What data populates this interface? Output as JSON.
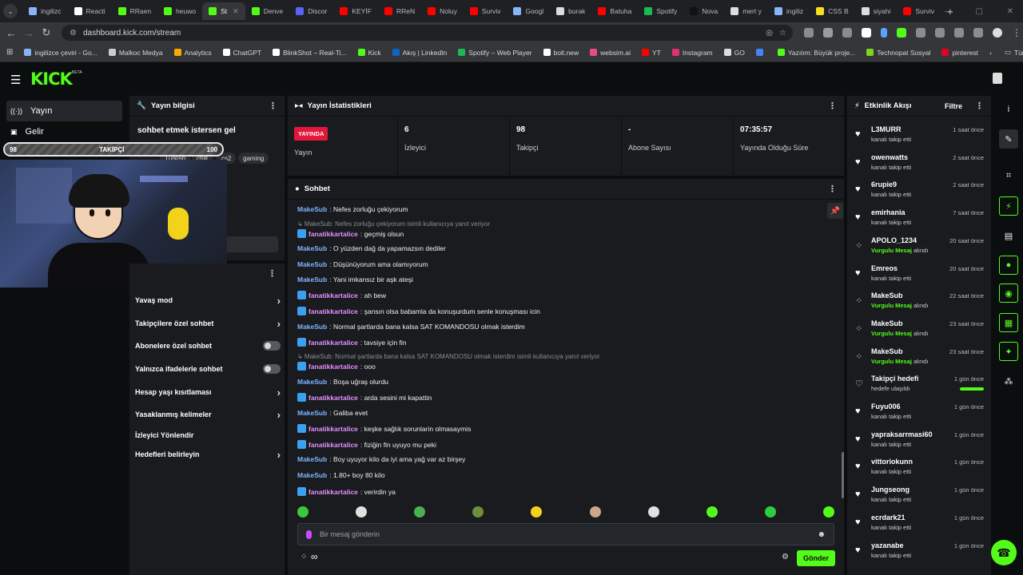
{
  "browser": {
    "tabs": [
      {
        "label": "ingilizc",
        "color": "#8ab4f8"
      },
      {
        "label": "Reacti",
        "color": "#ffffff"
      },
      {
        "label": "RRaen",
        "color": "#53fc18"
      },
      {
        "label": "heuwo",
        "color": "#53fc18"
      },
      {
        "label": "St",
        "color": "#53fc18",
        "active": true
      },
      {
        "label": "Denve",
        "color": "#53fc18"
      },
      {
        "label": "Discor",
        "color": "#5865f2"
      },
      {
        "label": "KEYİF",
        "color": "#ff0000"
      },
      {
        "label": "RReN",
        "color": "#ff0000"
      },
      {
        "label": "Noluy",
        "color": "#ff0000"
      },
      {
        "label": "Surviv",
        "color": "#ff0000"
      },
      {
        "label": "Googl",
        "color": "#8ab4f8"
      },
      {
        "label": "burak",
        "color": "#dddddd"
      },
      {
        "label": "Batuha",
        "color": "#ff0000"
      },
      {
        "label": "Spotify",
        "color": "#1db954"
      },
      {
        "label": "Nova",
        "color": "#111111"
      },
      {
        "label": "mert y",
        "color": "#dddddd"
      },
      {
        "label": "ingiliz",
        "color": "#8ab4f8"
      },
      {
        "label": "CSS B",
        "color": "#f7df1e"
      },
      {
        "label": "siyahi",
        "color": "#dddddd"
      },
      {
        "label": "Surviv",
        "color": "#ff0000"
      }
    ],
    "url": "dashboard.kick.com/stream",
    "bookmarks": [
      {
        "label": "ingilizce çeviri - Go...",
        "color": "#8ab4f8"
      },
      {
        "label": "Malkoc Medya",
        "color": "#cccccc"
      },
      {
        "label": "Analytics",
        "color": "#f9ab00"
      },
      {
        "label": "ChatGPT",
        "color": "#ffffff"
      },
      {
        "label": "BlinkShot – Real-Ti...",
        "color": "#ffffff"
      },
      {
        "label": "Kick",
        "color": "#53fc18"
      },
      {
        "label": "Akış | LinkedIn",
        "color": "#0a66c2"
      },
      {
        "label": "Spotify – Web Player",
        "color": "#1db954"
      },
      {
        "label": "bolt.new",
        "color": "#ffffff"
      },
      {
        "label": "websim.ai",
        "color": "#e84a8a"
      },
      {
        "label": "YT",
        "color": "#ff0000"
      },
      {
        "label": "Instagram",
        "color": "#e1306c"
      },
      {
        "label": "GO",
        "color": "#dddddd"
      },
      {
        "label": "",
        "color": "#4285f4"
      },
      {
        "label": "Yazılım: Büyük proje...",
        "color": "#53fc18"
      },
      {
        "label": "Technopat Sosyal",
        "color": "#7fd321"
      },
      {
        "label": "pinterest",
        "color": "#e60023"
      }
    ],
    "bookmarks_all": "Tüm Yer İşaretleri"
  },
  "brand": {
    "logo": "KICK",
    "beta": "BETA",
    "accent": "#53fc18"
  },
  "nav": {
    "items": [
      {
        "label": "Yayın",
        "icon": "broadcast-icon"
      },
      {
        "label": "Gelir",
        "icon": "revenue-icon"
      }
    ]
  },
  "stream_info": {
    "header": "Yayın bilgisi",
    "title": "sohbet etmek istersen gel",
    "tags": [
      "Türkish",
      "chill",
      "cs2",
      "gaming"
    ]
  },
  "follower_goal": {
    "current": "98",
    "label": "TAKİPÇİ",
    "target": "100",
    "progress": 0.98
  },
  "chat_settings": {
    "items": [
      {
        "label": "Yavaş mod",
        "control": "chevron"
      },
      {
        "label": "Takipçilere özel sohbet",
        "control": "chevron"
      },
      {
        "label": "Abonelere özel sohbet",
        "control": "toggle"
      },
      {
        "label": "Yalnızca ifadelerle sohbet",
        "control": "toggle"
      },
      {
        "label": "Hesap yaşı kısıtlaması",
        "control": "chevron"
      },
      {
        "label": "Yasaklanmış kelimeler",
        "control": "chevron"
      },
      {
        "label": "İzleyici Yönlendir",
        "control": "none"
      },
      {
        "label": "Hedefleri belirleyin",
        "control": "chevron"
      }
    ]
  },
  "stats": {
    "header": "Yayın İstatistikleri",
    "live_badge": "YAYINDA",
    "cells": [
      {
        "value": "",
        "label": "Yayın"
      },
      {
        "value": "6",
        "label": "İzleyici"
      },
      {
        "value": "98",
        "label": "Takipçi"
      },
      {
        "value": "-",
        "label": "Abone Sayısı"
      },
      {
        "value": "07:35:57",
        "label": "Yayında Olduğu Süre"
      }
    ]
  },
  "chat": {
    "header": "Sohbet",
    "messages": [
      {
        "type": "msg",
        "user": "MakeSub",
        "text": ": Nefes zorluğu çekiyorum"
      },
      {
        "type": "reply",
        "text": "↳ MakeSub: Nefes zorluğu çekiyorum isimli kullanıcıya yanıt veriyor"
      },
      {
        "type": "msg",
        "user": "fanatikkartalice",
        "text": ": geçmiş olsun"
      },
      {
        "type": "msg",
        "user": "MakeSub",
        "text": ": O yüzden dağ da yapamazsın dediler"
      },
      {
        "type": "msg",
        "user": "MakeSub",
        "text": ": Düşünüyorum ama olamıyorum"
      },
      {
        "type": "msg",
        "user": "MakeSub",
        "text": ": Yani imkansız bir aşk ateşi"
      },
      {
        "type": "msg",
        "user": "fanatikkartalice",
        "text": ": ah bew"
      },
      {
        "type": "msg",
        "user": "fanatikkartalice",
        "text": ": şansın olsa babamla da konuşurdum senle konuşması icin"
      },
      {
        "type": "msg",
        "user": "MakeSub",
        "text": ": Normal şartlarda bana kalsa SAT KOMANDOSU olmak isterdim"
      },
      {
        "type": "msg",
        "user": "fanatikkartalice",
        "text": ": tavsiye için fin"
      },
      {
        "type": "reply",
        "text": "↳ MakeSub: Normal şartlarda bana kalsa SAT KOMANDOSU olmak isterdim isimli kullanıcıya yanıt veriyor"
      },
      {
        "type": "msg",
        "user": "fanatikkartalice",
        "text": ": ooo"
      },
      {
        "type": "msg",
        "user": "MakeSub",
        "text": ": Boşa uğraş olurdu"
      },
      {
        "type": "msg",
        "user": "fanatikkartalice",
        "text": ": arda sesini mi kapattin"
      },
      {
        "type": "msg",
        "user": "MakeSub",
        "text": ": Galiba evet"
      },
      {
        "type": "msg",
        "user": "fanatikkartalice",
        "text": ": keşke sağlık sorunlarin olmasaymis"
      },
      {
        "type": "msg",
        "user": "fanatikkartalice",
        "text": ": fiziğin fin uyuyo mu peki"
      },
      {
        "type": "msg",
        "user": "MakeSub",
        "text": ": Boy uyuyor kilo da iyi ama yağ var az birşey"
      },
      {
        "type": "msg",
        "user": "MakeSub",
        "text": ": 1.80+ boy 80 kilo"
      },
      {
        "type": "msg",
        "user": "fanatikkartalice",
        "text": ": verirdin ya"
      }
    ],
    "emotes": [
      "#3cc83c",
      "#e0e0e0",
      "#4caf50",
      "#6d8f3a",
      "#f2d21a",
      "#c9a58a",
      "#e0e0e0",
      "#53fc18",
      "#2ecc40",
      "#53fc18"
    ],
    "input_placeholder": "Bir mesaj gönderin",
    "infinity": "∞",
    "send_label": "Gönder"
  },
  "activity": {
    "header": "Etkinlik Akışı",
    "filter_label": "Filtre",
    "items": [
      {
        "name": "L3MURR",
        "sub": "kanalı takip etti",
        "time": "1 saat önce",
        "icon": "heart"
      },
      {
        "name": "owenwatts",
        "sub": "kanalı takip etti",
        "time": "2 saat önce",
        "icon": "heart"
      },
      {
        "name": "6rupie9",
        "sub": "kanalı takip etti",
        "time": "2 saat önce",
        "icon": "heart"
      },
      {
        "name": "emirhania",
        "sub": "kanalı takip etti",
        "time": "7 saat önce",
        "icon": "heart"
      },
      {
        "name": "APOLO_1234",
        "sub_hl": "Vurgulu Mesaj",
        "sub": " alındı",
        "time": "20 saat önce",
        "icon": "dots"
      },
      {
        "name": "Emreos",
        "sub": "kanalı takip etti",
        "time": "20 saat önce",
        "icon": "heart"
      },
      {
        "name": "MakeSub",
        "sub_hl": "Vurgulu Mesaj",
        "sub": " alındı",
        "time": "22 saat önce",
        "icon": "dots"
      },
      {
        "name": "MakeSub",
        "sub_hl": "Vurgulu Mesaj",
        "sub": " alındı",
        "time": "23 saat önce",
        "icon": "dots"
      },
      {
        "name": "MakeSub",
        "sub_hl": "Vurgulu Mesaj",
        "sub": " alındı",
        "time": "23 saat önce",
        "icon": "dots"
      },
      {
        "name": "Takipçi hedefi",
        "sub": "hedefe ulaşıldı",
        "time": "1 gün önce",
        "icon": "heart-outline",
        "progress": 1.0
      },
      {
        "name": "Fuyu006",
        "sub": "kanalı takip etti",
        "time": "1 gün önce",
        "icon": "heart"
      },
      {
        "name": "yapraksarrmasi60",
        "sub": "kanalı takip etti",
        "time": "1 gün önce",
        "icon": "heart"
      },
      {
        "name": "vittoriokunn",
        "sub": "kanalı takip etti",
        "time": "1 gün önce",
        "icon": "heart"
      },
      {
        "name": "Jungseong",
        "sub": "kanalı takip etti",
        "time": "1 gün önce",
        "icon": "heart"
      },
      {
        "name": "ecrdark21",
        "sub": "kanalı takip etti",
        "time": "1 gün önce",
        "icon": "heart"
      },
      {
        "name": "yazanabe",
        "sub": "kanalı takip etti",
        "time": "1 gün önce",
        "icon": "heart"
      }
    ]
  },
  "rail": {
    "buttons": [
      {
        "name": "info-icon",
        "glyph": "i",
        "style": "plain"
      },
      {
        "name": "edit-icon",
        "glyph": "✎",
        "style": "selected"
      },
      {
        "name": "camera-icon",
        "glyph": "⌗",
        "style": "plain"
      },
      {
        "name": "bolt-icon",
        "glyph": "⚡",
        "style": "boxed"
      },
      {
        "name": "clipboard-icon",
        "glyph": "▤",
        "style": "plain"
      },
      {
        "name": "chat-icon",
        "glyph": "●",
        "style": "boxed"
      },
      {
        "name": "broadcast-icon",
        "glyph": "◉",
        "style": "boxed"
      },
      {
        "name": "stats-icon",
        "glyph": "▦",
        "style": "boxed"
      },
      {
        "name": "wrench-icon",
        "glyph": "✦",
        "style": "boxed"
      },
      {
        "name": "apps-icon",
        "glyph": "⁂",
        "style": "plain"
      }
    ]
  }
}
